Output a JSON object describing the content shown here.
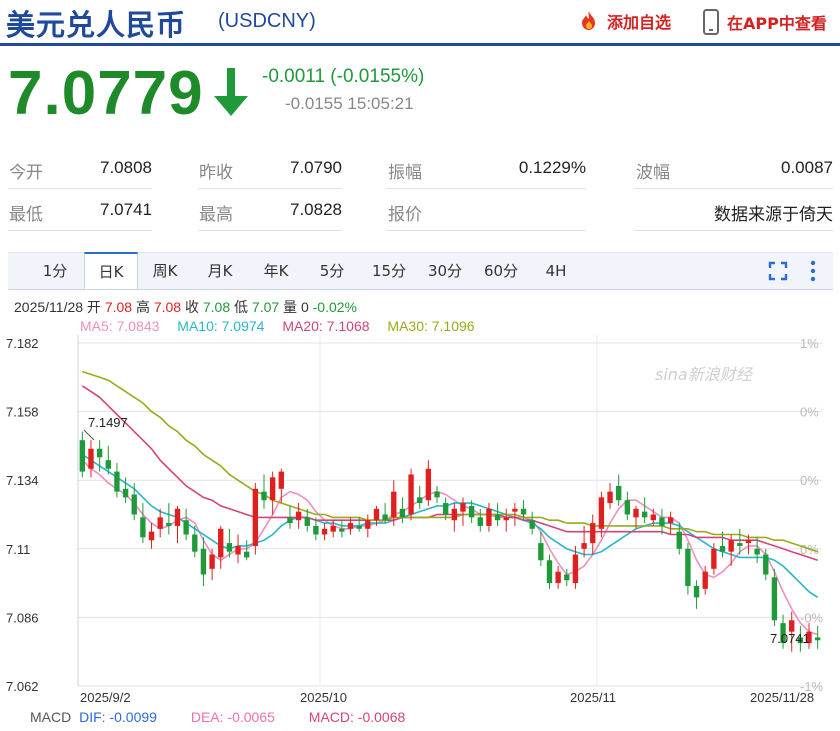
{
  "header": {
    "title": "美元兑人民币",
    "code": "(USDCNY)",
    "add_favorite": "添加自选",
    "view_in_app": "在APP中查看"
  },
  "quote": {
    "price": "7.0779",
    "change": "-0.0011 (-0.0155%)",
    "sub_change": "-0.0155",
    "time": "15:05:21",
    "direction": "down",
    "color": "#1e8a2a"
  },
  "stats": [
    {
      "label": "今开",
      "value": "7.0808"
    },
    {
      "label": "昨收",
      "value": "7.0790"
    },
    {
      "label": "振幅",
      "value": "0.1229%"
    },
    {
      "label": "波幅",
      "value": "0.0087"
    },
    {
      "label": "最低",
      "value": "7.0741"
    },
    {
      "label": "最高",
      "value": "7.0828"
    },
    {
      "label": "报价",
      "value": ""
    },
    {
      "label": "",
      "value": "数据来源于倚天"
    }
  ],
  "tabs": [
    "1分",
    "日K",
    "周K",
    "月K",
    "年K",
    "5分",
    "15分",
    "30分",
    "60分",
    "4H"
  ],
  "active_tab": "日K",
  "toolbar_icons": [
    "fullscreen-icon",
    "more-vertical-icon"
  ],
  "info": {
    "date": "2025/11/28",
    "open_label": "开",
    "open": "7.08",
    "high_label": "高",
    "high": "7.08",
    "close_label": "收",
    "close": "7.08",
    "low_label": "低",
    "low": "7.07",
    "vol_label": "量",
    "vol": "0",
    "pct": "-0.02%",
    "ma5": "MA5: 7.0843",
    "ma10": "MA10: 7.0974",
    "ma20": "MA20: 7.1068",
    "ma30": "MA30: 7.1096"
  },
  "macd": {
    "label": "MACD",
    "dif": "DIF: -0.0099",
    "dea": "DEA: -0.0065",
    "macd": "MACD: -0.0068"
  },
  "watermark": "sina新浪财经",
  "chart_data": {
    "type": "candlestick",
    "y_ticks": [
      "7.182",
      "7.158",
      "7.134",
      "7.11",
      "7.086",
      "7.062"
    ],
    "y_range": [
      7.062,
      7.182
    ],
    "right_ticks": [
      "1%",
      "0%",
      "0%",
      "0%",
      "-0%",
      "-1%"
    ],
    "x_labels": [
      "2025/9/2",
      "2025/10",
      "2025/11",
      "2025/11/28"
    ],
    "max_label": "7.1497",
    "min_label": "7.0741",
    "up_color": "#e02020",
    "down_color": "#1e9a3a",
    "candles": [
      [
        7.148,
        7.151,
        7.135,
        7.137
      ],
      [
        7.138,
        7.148,
        7.135,
        7.145
      ],
      [
        7.145,
        7.148,
        7.137,
        7.142
      ],
      [
        7.141,
        7.146,
        7.136,
        7.138
      ],
      [
        7.137,
        7.14,
        7.128,
        7.13
      ],
      [
        7.131,
        7.135,
        7.126,
        7.128
      ],
      [
        7.129,
        7.133,
        7.12,
        7.122
      ],
      [
        7.121,
        7.126,
        7.112,
        7.114
      ],
      [
        7.113,
        7.119,
        7.11,
        7.116
      ],
      [
        7.117,
        7.124,
        7.114,
        7.121
      ],
      [
        7.119,
        7.126,
        7.115,
        7.118
      ],
      [
        7.118,
        7.125,
        7.112,
        7.124
      ],
      [
        7.12,
        7.124,
        7.113,
        7.115
      ],
      [
        7.115,
        7.118,
        7.107,
        7.109
      ],
      [
        7.11,
        7.114,
        7.097,
        7.101
      ],
      [
        7.103,
        7.11,
        7.099,
        7.108
      ],
      [
        7.107,
        7.118,
        7.103,
        7.117
      ],
      [
        7.112,
        7.117,
        7.107,
        7.109
      ],
      [
        7.108,
        7.115,
        7.105,
        7.111
      ],
      [
        7.109,
        7.113,
        7.106,
        7.107
      ],
      [
        7.111,
        7.133,
        7.108,
        7.131
      ],
      [
        7.13,
        7.136,
        7.124,
        7.127
      ],
      [
        7.127,
        7.137,
        7.122,
        7.135
      ],
      [
        7.131,
        7.138,
        7.126,
        7.137
      ],
      [
        7.121,
        7.125,
        7.117,
        7.119
      ],
      [
        7.12,
        7.126,
        7.117,
        7.123
      ],
      [
        7.121,
        7.124,
        7.116,
        7.118
      ],
      [
        7.118,
        7.121,
        7.113,
        7.115
      ],
      [
        7.115,
        7.119,
        7.113,
        7.117
      ],
      [
        7.116,
        7.12,
        7.114,
        7.118
      ],
      [
        7.117,
        7.12,
        7.114,
        7.116
      ],
      [
        7.117,
        7.121,
        7.115,
        7.119
      ],
      [
        7.118,
        7.121,
        7.116,
        7.117
      ],
      [
        7.117,
        7.122,
        7.114,
        7.12
      ],
      [
        7.12,
        7.125,
        7.118,
        7.124
      ],
      [
        7.122,
        7.126,
        7.119,
        7.12
      ],
      [
        7.121,
        7.134,
        7.118,
        7.13
      ],
      [
        7.124,
        7.128,
        7.119,
        7.121
      ],
      [
        7.122,
        7.138,
        7.12,
        7.136
      ],
      [
        7.128,
        7.132,
        7.124,
        7.126
      ],
      [
        7.127,
        7.141,
        7.125,
        7.138
      ],
      [
        7.13,
        7.132,
        7.126,
        7.128
      ],
      [
        7.126,
        7.128,
        7.12,
        7.122
      ],
      [
        7.12,
        7.126,
        7.116,
        7.124
      ],
      [
        7.123,
        7.128,
        7.118,
        7.126
      ],
      [
        7.125,
        7.127,
        7.119,
        7.121
      ],
      [
        7.121,
        7.124,
        7.116,
        7.118
      ],
      [
        7.118,
        7.126,
        7.116,
        7.124
      ],
      [
        7.122,
        7.126,
        7.118,
        7.12
      ],
      [
        7.12,
        7.124,
        7.116,
        7.121
      ],
      [
        7.123,
        7.126,
        7.118,
        7.124
      ],
      [
        7.124,
        7.127,
        7.12,
        7.122
      ],
      [
        7.12,
        7.123,
        7.115,
        7.117
      ],
      [
        7.112,
        7.116,
        7.104,
        7.106
      ],
      [
        7.106,
        7.108,
        7.096,
        7.098
      ],
      [
        7.098,
        7.104,
        7.096,
        7.102
      ],
      [
        7.101,
        7.103,
        7.097,
        7.099
      ],
      [
        7.098,
        7.111,
        7.096,
        7.108
      ],
      [
        7.11,
        7.118,
        7.107,
        7.112
      ],
      [
        7.112,
        7.122,
        7.108,
        7.119
      ],
      [
        7.117,
        7.13,
        7.114,
        7.128
      ],
      [
        7.126,
        7.133,
        7.124,
        7.13
      ],
      [
        7.132,
        7.136,
        7.125,
        7.127
      ],
      [
        7.127,
        7.13,
        7.12,
        7.122
      ],
      [
        7.121,
        7.125,
        7.117,
        7.124
      ],
      [
        7.123,
        7.128,
        7.119,
        7.121
      ],
      [
        7.12,
        7.124,
        7.118,
        7.122
      ],
      [
        7.121,
        7.124,
        7.115,
        7.118
      ],
      [
        7.119,
        7.123,
        7.115,
        7.121
      ],
      [
        7.116,
        7.119,
        7.108,
        7.11
      ],
      [
        7.11,
        7.112,
        7.094,
        7.097
      ],
      [
        7.097,
        7.099,
        7.089,
        7.093
      ],
      [
        7.096,
        7.104,
        7.094,
        7.102
      ],
      [
        7.103,
        7.112,
        7.101,
        7.11
      ],
      [
        7.111,
        7.116,
        7.107,
        7.109
      ],
      [
        7.109,
        7.115,
        7.104,
        7.113
      ],
      [
        7.112,
        7.117,
        7.108,
        7.111
      ],
      [
        7.112,
        7.115,
        7.108,
        7.113
      ],
      [
        7.11,
        7.114,
        7.105,
        7.108
      ],
      [
        7.108,
        7.11,
        7.099,
        7.101
      ],
      [
        7.1,
        7.103,
        7.083,
        7.085
      ],
      [
        7.084,
        7.087,
        7.075,
        7.077
      ],
      [
        7.081,
        7.088,
        7.074,
        7.085
      ],
      [
        7.079,
        7.083,
        7.074,
        7.077
      ],
      [
        7.077,
        7.084,
        7.075,
        7.081
      ],
      [
        7.079,
        7.083,
        7.075,
        7.078
      ]
    ],
    "ma_series": [
      {
        "name": "MA5",
        "color": "#ef8fbd",
        "values": [
          7.141,
          7.138,
          7.136,
          7.133,
          7.131,
          7.129,
          7.126,
          7.122,
          7.119,
          7.117,
          7.118,
          7.12,
          7.121,
          7.119,
          7.113,
          7.108,
          7.106,
          7.108,
          7.11,
          7.11,
          7.112,
          7.117,
          7.122,
          7.128,
          7.13,
          7.129,
          7.127,
          7.123,
          7.12,
          7.118,
          7.117,
          7.117,
          7.118,
          7.118,
          7.119,
          7.12,
          7.122,
          7.123,
          7.125,
          7.127,
          7.129,
          7.13,
          7.129,
          7.127,
          7.125,
          7.124,
          7.122,
          7.122,
          7.121,
          7.121,
          7.121,
          7.121,
          7.12,
          7.116,
          7.11,
          7.105,
          7.101,
          7.102,
          7.104,
          7.108,
          7.113,
          7.119,
          7.124,
          7.127,
          7.127,
          7.125,
          7.123,
          7.121,
          7.121,
          7.119,
          7.113,
          7.106,
          7.101,
          7.1,
          7.102,
          7.105,
          7.109,
          7.111,
          7.111,
          7.108,
          7.102,
          7.095,
          7.089,
          7.084,
          7.081,
          7.08
        ]
      },
      {
        "name": "MA10",
        "color": "#27b7c8",
        "values": [
          7.143,
          7.141,
          7.139,
          7.137,
          7.135,
          7.133,
          7.131,
          7.128,
          7.125,
          7.123,
          7.122,
          7.121,
          7.119,
          7.117,
          7.115,
          7.113,
          7.111,
          7.11,
          7.111,
          7.111,
          7.112,
          7.113,
          7.115,
          7.118,
          7.12,
          7.121,
          7.121,
          7.12,
          7.119,
          7.119,
          7.118,
          7.118,
          7.118,
          7.119,
          7.119,
          7.119,
          7.12,
          7.121,
          7.122,
          7.123,
          7.124,
          7.125,
          7.125,
          7.126,
          7.126,
          7.126,
          7.125,
          7.124,
          7.123,
          7.122,
          7.121,
          7.12,
          7.119,
          7.117,
          7.114,
          7.112,
          7.11,
          7.109,
          7.108,
          7.108,
          7.109,
          7.111,
          7.113,
          7.115,
          7.117,
          7.118,
          7.119,
          7.119,
          7.119,
          7.118,
          7.116,
          7.114,
          7.112,
          7.11,
          7.109,
          7.108,
          7.107,
          7.107,
          7.107,
          7.107,
          7.106,
          7.104,
          7.101,
          7.098,
          7.095,
          7.093
        ]
      },
      {
        "name": "MA20",
        "color": "#d2457a",
        "values": [
          7.167,
          7.165,
          7.163,
          7.16,
          7.157,
          7.154,
          7.151,
          7.148,
          7.145,
          7.141,
          7.138,
          7.135,
          7.132,
          7.13,
          7.128,
          7.127,
          7.125,
          7.124,
          7.123,
          7.122,
          7.121,
          7.121,
          7.121,
          7.121,
          7.121,
          7.121,
          7.121,
          7.12,
          7.12,
          7.12,
          7.12,
          7.12,
          7.12,
          7.12,
          7.12,
          7.12,
          7.12,
          7.121,
          7.121,
          7.121,
          7.121,
          7.122,
          7.122,
          7.122,
          7.122,
          7.122,
          7.122,
          7.122,
          7.122,
          7.121,
          7.121,
          7.12,
          7.12,
          7.119,
          7.118,
          7.117,
          7.116,
          7.116,
          7.116,
          7.116,
          7.116,
          7.116,
          7.116,
          7.116,
          7.116,
          7.116,
          7.116,
          7.116,
          7.115,
          7.115,
          7.115,
          7.114,
          7.114,
          7.114,
          7.114,
          7.113,
          7.113,
          7.113,
          7.113,
          7.112,
          7.111,
          7.11,
          7.109,
          7.108,
          7.107,
          7.106
        ]
      },
      {
        "name": "MA30",
        "color": "#9aaa1c",
        "values": [
          7.172,
          7.171,
          7.17,
          7.169,
          7.167,
          7.165,
          7.163,
          7.161,
          7.158,
          7.156,
          7.153,
          7.151,
          7.148,
          7.146,
          7.143,
          7.141,
          7.139,
          7.136,
          7.134,
          7.132,
          7.13,
          7.129,
          7.127,
          7.126,
          7.125,
          7.124,
          7.123,
          7.122,
          7.122,
          7.121,
          7.121,
          7.121,
          7.121,
          7.12,
          7.12,
          7.12,
          7.121,
          7.121,
          7.121,
          7.121,
          7.121,
          7.121,
          7.121,
          7.121,
          7.122,
          7.122,
          7.122,
          7.122,
          7.122,
          7.122,
          7.122,
          7.121,
          7.121,
          7.121,
          7.12,
          7.12,
          7.119,
          7.119,
          7.119,
          7.118,
          7.118,
          7.118,
          7.118,
          7.118,
          7.118,
          7.118,
          7.118,
          7.118,
          7.117,
          7.117,
          7.117,
          7.116,
          7.116,
          7.115,
          7.115,
          7.115,
          7.115,
          7.114,
          7.114,
          7.114,
          7.113,
          7.113,
          7.112,
          7.111,
          7.11,
          7.109
        ]
      }
    ]
  }
}
